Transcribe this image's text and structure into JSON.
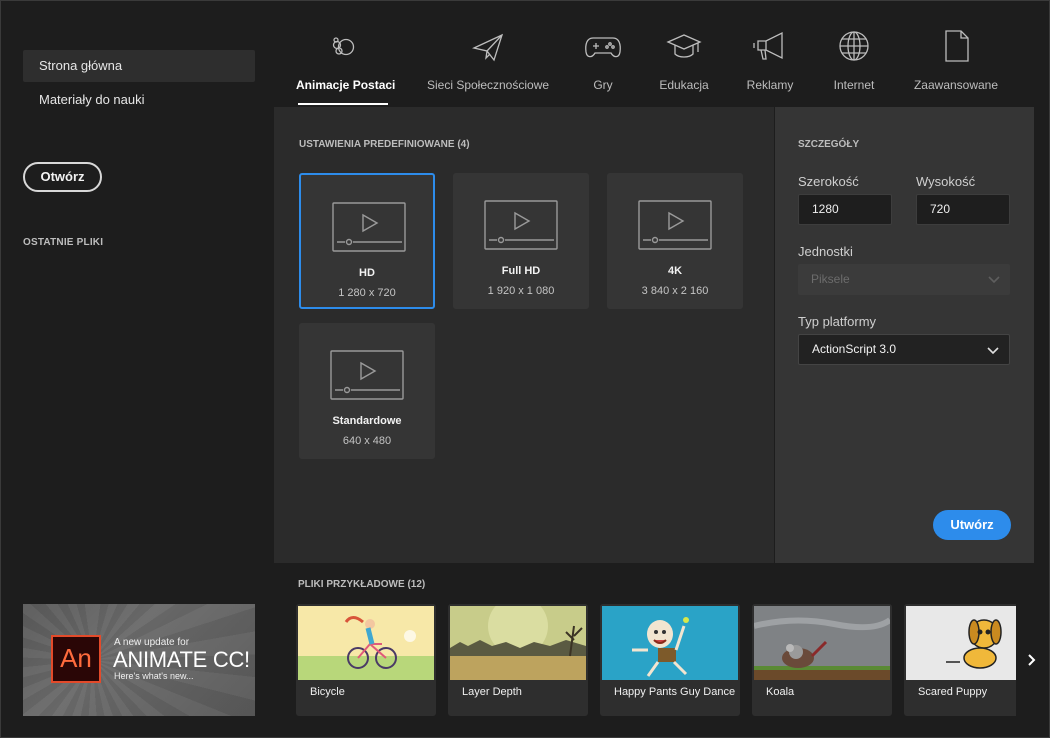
{
  "sidebar": {
    "items": [
      {
        "label": "Strona główna"
      },
      {
        "label": "Materiały do nauki"
      }
    ],
    "open_button": "Otwórz",
    "recent_label": "OSTATNIE PLIKI"
  },
  "banner": {
    "logo": "An",
    "line1": "A new update for",
    "line2": "ANIMATE CC!",
    "line3": "Here's what's new..."
  },
  "tabs": [
    {
      "label": "Animacje Postaci",
      "icon": "character-animation-icon"
    },
    {
      "label": "Sieci Społecznościowe",
      "icon": "paper-plane-icon"
    },
    {
      "label": "Gry",
      "icon": "gamepad-icon"
    },
    {
      "label": "Edukacja",
      "icon": "graduation-cap-icon"
    },
    {
      "label": "Reklamy",
      "icon": "megaphone-icon"
    },
    {
      "label": "Internet",
      "icon": "globe-icon"
    },
    {
      "label": "Zaawansowane",
      "icon": "document-icon"
    }
  ],
  "presets": {
    "title": "USTAWIENIA PREDEFINIOWANE (4)",
    "items": [
      {
        "name": "HD",
        "size": "1 280 x 720"
      },
      {
        "name": "Full HD",
        "size": "1 920 x 1 080"
      },
      {
        "name": "4K",
        "size": "3 840 x 2 160"
      },
      {
        "name": "Standardowe",
        "size": "640 x 480"
      }
    ]
  },
  "details": {
    "title": "SZCZEGÓŁY",
    "width_label": "Szerokość",
    "width_value": "1280",
    "height_label": "Wysokość",
    "height_value": "720",
    "units_label": "Jednostki",
    "units_value": "Piksele",
    "platform_label": "Typ platformy",
    "platform_value": "ActionScript 3.0",
    "create_button": "Utwórz"
  },
  "samples": {
    "title": "PLIKI PRZYKŁADOWE (12)",
    "items": [
      {
        "name": "Bicycle"
      },
      {
        "name": "Layer Depth"
      },
      {
        "name": "Happy Pants Guy Dance"
      },
      {
        "name": "Koala"
      },
      {
        "name": "Scared Puppy"
      }
    ]
  },
  "colors": {
    "accent": "#2d8ceb",
    "background": "#1d1d1d",
    "panel": "#2b2b2b",
    "details_panel": "#353535"
  }
}
